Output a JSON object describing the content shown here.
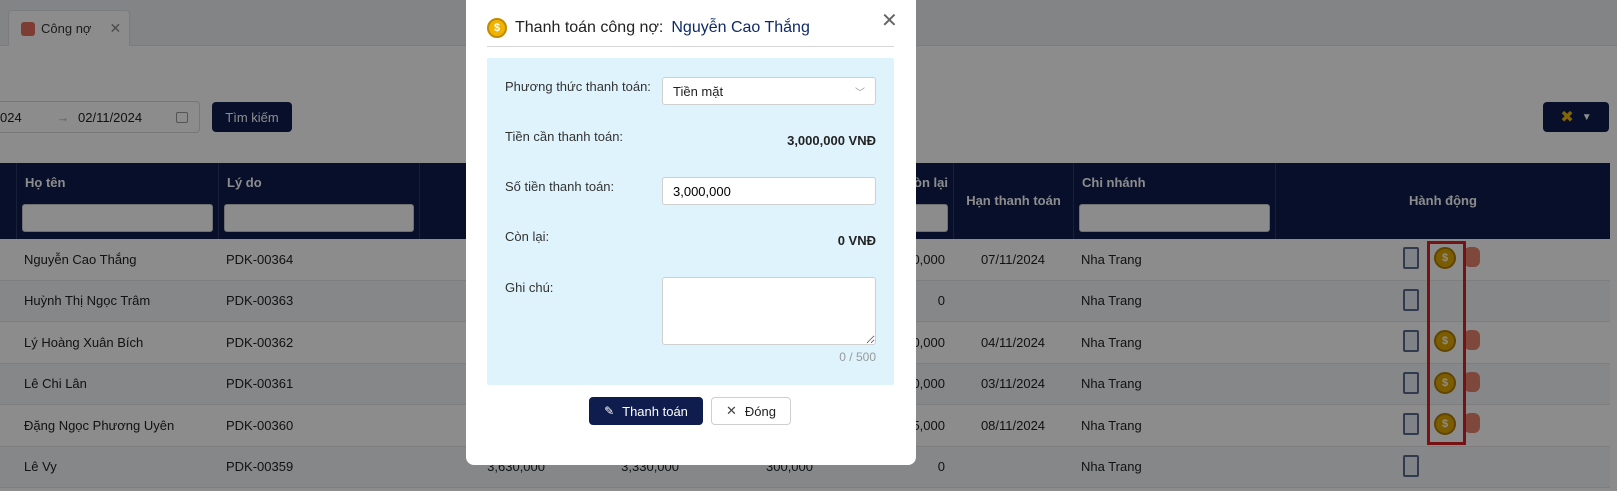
{
  "tab": {
    "label": "Công nợ"
  },
  "filters": {
    "date_from": "024",
    "date_to": "02/11/2024",
    "search_label": "Tìm kiếm"
  },
  "grid": {
    "headers": {
      "name": "Họ tên",
      "reason": "Lý do",
      "remaining": "òn lại",
      "due": "Hạn thanh toán",
      "branch": "Chi nhánh",
      "action": "Hành động"
    },
    "rows": [
      {
        "name": "Nguyễn Cao Thắng",
        "reason": "PDK-00364",
        "c1": "",
        "c2": "",
        "c3": "",
        "remaining": "0,000",
        "due": "07/11/2024",
        "branch": "Nha Trang",
        "pay": true
      },
      {
        "name": "Huỳnh Thị Ngọc Trâm",
        "reason": "PDK-00363",
        "c1": "",
        "c2": "",
        "c3": "",
        "remaining": "0",
        "due": "",
        "branch": "Nha Trang",
        "pay": false
      },
      {
        "name": "Lý Hoàng Xuân Bích",
        "reason": "PDK-00362",
        "c1": "",
        "c2": "",
        "c3": "",
        "remaining": "0,000",
        "due": "04/11/2024",
        "branch": "Nha Trang",
        "pay": true
      },
      {
        "name": "Lê Chi Lân",
        "reason": "PDK-00361",
        "c1": "",
        "c2": "",
        "c3": "",
        "remaining": "0,000",
        "due": "03/11/2024",
        "branch": "Nha Trang",
        "pay": true
      },
      {
        "name": "Đặng Ngọc Phương Uyên",
        "reason": "PDK-00360",
        "c1": "",
        "c2": "",
        "c3": "",
        "remaining": "5,000",
        "due": "08/11/2024",
        "branch": "Nha Trang",
        "pay": true
      },
      {
        "name": "Lê Vy",
        "reason": "PDK-00359",
        "c1": "3,630,000",
        "c2": "3,330,000",
        "c3": "300,000",
        "remaining": "0",
        "due": "",
        "branch": "Nha Trang",
        "pay": false
      }
    ]
  },
  "modal": {
    "title": "Thanh toán công nợ:",
    "customer": "Nguyễn Cao Thắng",
    "method_label": "Phương thức thanh toán:",
    "method_value": "Tiền mặt",
    "due_label": "Tiền cần thanh toán:",
    "due_value": "3,000,000 VNĐ",
    "amount_label": "Số tiền thanh toán:",
    "amount_value": "3,000,000",
    "remaining_label": "Còn lại:",
    "remaining_value": "0 VNĐ",
    "note_label": "Ghi chú:",
    "note_counter": "0 / 500",
    "pay_label": "Thanh toán",
    "close_label": "Đóng"
  }
}
